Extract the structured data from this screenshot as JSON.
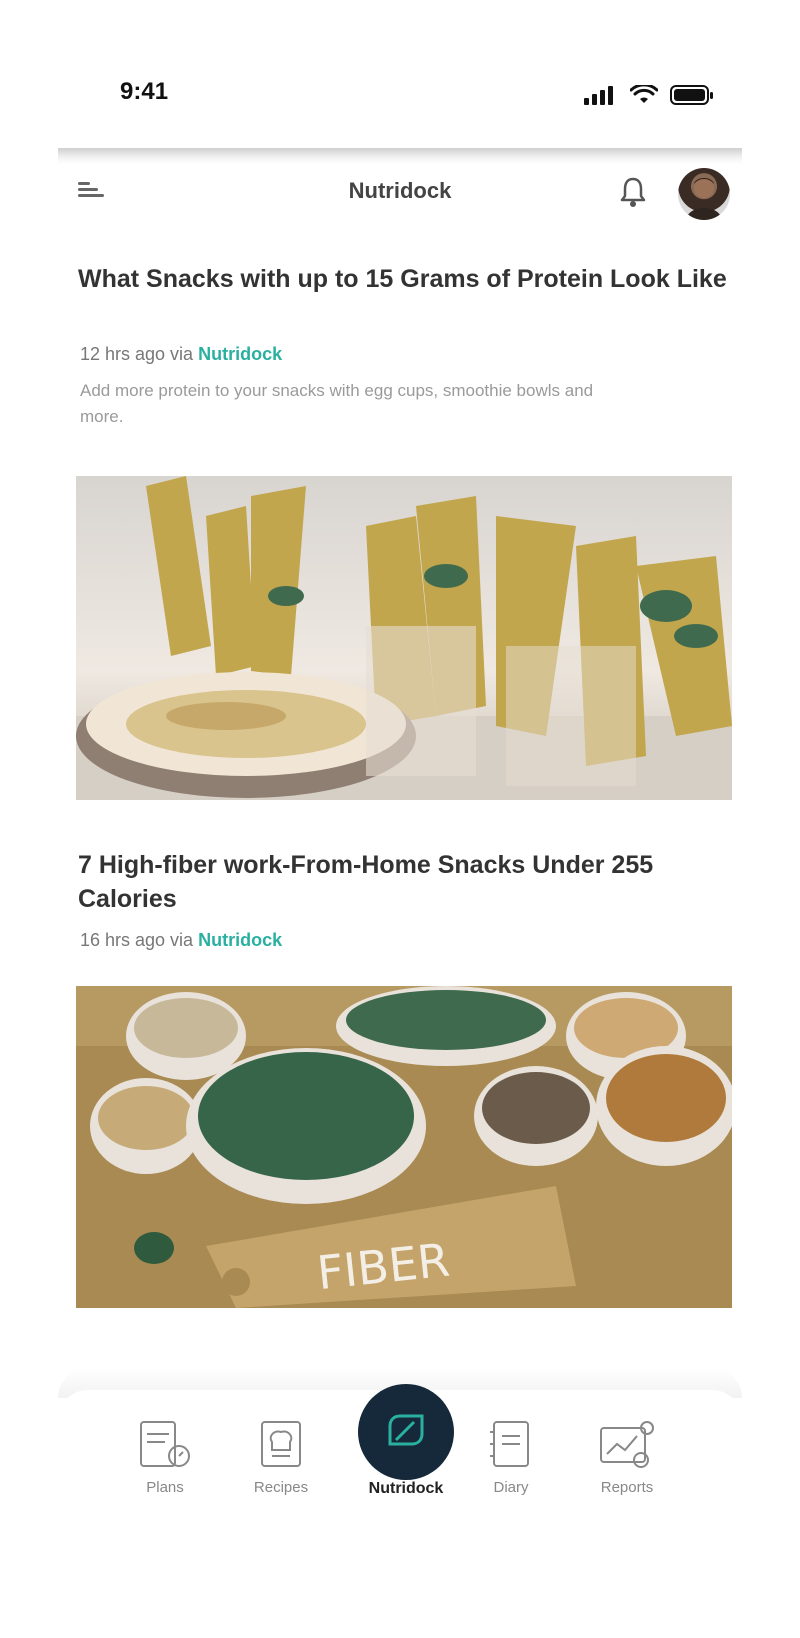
{
  "status_bar": {
    "time": "9:41"
  },
  "header": {
    "title": "Nutridock",
    "menu_icon": "hamburger-menu-icon",
    "bell_icon": "bell-icon",
    "avatar_icon": "user-avatar"
  },
  "articles": [
    {
      "title": "What Snacks with up to 15 Grams of Protein Look Like",
      "time": "12 hrs ago via ",
      "source": "Nutridock",
      "description": "Add more protein to your snacks with egg cups, smoothie bowls and more.",
      "image": "snack-hummus-veggie-sticks-photo"
    },
    {
      "title": "7 High-fiber work-From-Home Snacks Under 255 Calories",
      "time": "16 hrs ago via ",
      "source": "Nutridock",
      "image": "fiber-foods-bowls-photo",
      "image_text": "FIBER"
    }
  ],
  "bottom_nav": {
    "items": [
      {
        "label": "Plans",
        "icon": "plans-icon"
      },
      {
        "label": "Recipes",
        "icon": "recipes-icon"
      },
      {
        "label": "Nutridock",
        "icon": "nutridock-leaf-icon",
        "active": true
      },
      {
        "label": "Diary",
        "icon": "diary-icon"
      },
      {
        "label": "Reports",
        "icon": "reports-icon"
      }
    ]
  },
  "colors": {
    "accent": "#2ab0a0",
    "fab": "#15293a",
    "title_text": "#333333",
    "muted_text": "#777777"
  }
}
